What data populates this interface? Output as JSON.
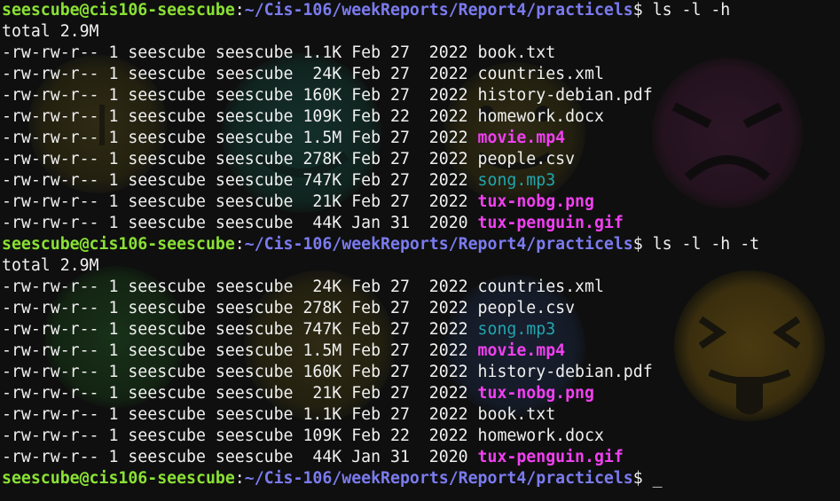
{
  "prompt": {
    "user_host": "seescube@cis106-seescube",
    "colon": ":",
    "path": "~/Cis-106/weekReports/Report4/practicels",
    "dollar": "$"
  },
  "blocks": [
    {
      "command": " ls -l -h",
      "total": "total 2.9M",
      "rows": [
        {
          "meta": "-rw-rw-r-- 1 seescube seescube 1.1K Feb 27  2022 ",
          "name": "book.txt",
          "kind": "plain"
        },
        {
          "meta": "-rw-rw-r-- 1 seescube seescube  24K Feb 27  2022 ",
          "name": "countries.xml",
          "kind": "plain"
        },
        {
          "meta": "-rw-rw-r-- 1 seescube seescube 160K Feb 27  2022 ",
          "name": "history-debian.pdf",
          "kind": "plain"
        },
        {
          "meta": "-rw-rw-r-- 1 seescube seescube 109K Feb 22  2022 ",
          "name": "homework.docx",
          "kind": "plain"
        },
        {
          "meta": "-rw-rw-r-- 1 seescube seescube 1.5M Feb 27  2022 ",
          "name": "movie.mp4",
          "kind": "video"
        },
        {
          "meta": "-rw-rw-r-- 1 seescube seescube 278K Feb 27  2022 ",
          "name": "people.csv",
          "kind": "plain"
        },
        {
          "meta": "-rw-rw-r-- 1 seescube seescube 747K Feb 27  2022 ",
          "name": "song.mp3",
          "kind": "audio"
        },
        {
          "meta": "-rw-rw-r-- 1 seescube seescube  21K Feb 27  2022 ",
          "name": "tux-nobg.png",
          "kind": "image"
        },
        {
          "meta": "-rw-rw-r-- 1 seescube seescube  44K Jan 31  2020 ",
          "name": "tux-penguin.gif",
          "kind": "image"
        }
      ]
    },
    {
      "command": " ls -l -h -t",
      "total": "total 2.9M",
      "rows": [
        {
          "meta": "-rw-rw-r-- 1 seescube seescube  24K Feb 27  2022 ",
          "name": "countries.xml",
          "kind": "plain"
        },
        {
          "meta": "-rw-rw-r-- 1 seescube seescube 278K Feb 27  2022 ",
          "name": "people.csv",
          "kind": "plain"
        },
        {
          "meta": "-rw-rw-r-- 1 seescube seescube 747K Feb 27  2022 ",
          "name": "song.mp3",
          "kind": "audio"
        },
        {
          "meta": "-rw-rw-r-- 1 seescube seescube 1.5M Feb 27  2022 ",
          "name": "movie.mp4",
          "kind": "video"
        },
        {
          "meta": "-rw-rw-r-- 1 seescube seescube 160K Feb 27  2022 ",
          "name": "history-debian.pdf",
          "kind": "plain"
        },
        {
          "meta": "-rw-rw-r-- 1 seescube seescube  21K Feb 27  2022 ",
          "name": "tux-nobg.png",
          "kind": "image"
        },
        {
          "meta": "-rw-rw-r-- 1 seescube seescube 1.1K Feb 27  2022 ",
          "name": "book.txt",
          "kind": "plain"
        },
        {
          "meta": "-rw-rw-r-- 1 seescube seescube 109K Feb 22  2022 ",
          "name": "homework.docx",
          "kind": "plain"
        },
        {
          "meta": "-rw-rw-r-- 1 seescube seescube  44K Jan 31  2020 ",
          "name": "tux-penguin.gif",
          "kind": "image"
        }
      ]
    }
  ],
  "final_prompt": {
    "input": " ",
    "cursor": "_"
  },
  "colors": {
    "background": "#0f0f0f",
    "prompt_user": "#8ae234",
    "prompt_path": "#7b7bf0",
    "video_image_files": "#f040f0",
    "audio_files": "#20a6b0",
    "text": "#f0f0f0"
  },
  "wallpaper": {
    "description_icons": [
      "smiley-face-icon",
      "angry-face-icon",
      "tongue-face-icon"
    ]
  }
}
